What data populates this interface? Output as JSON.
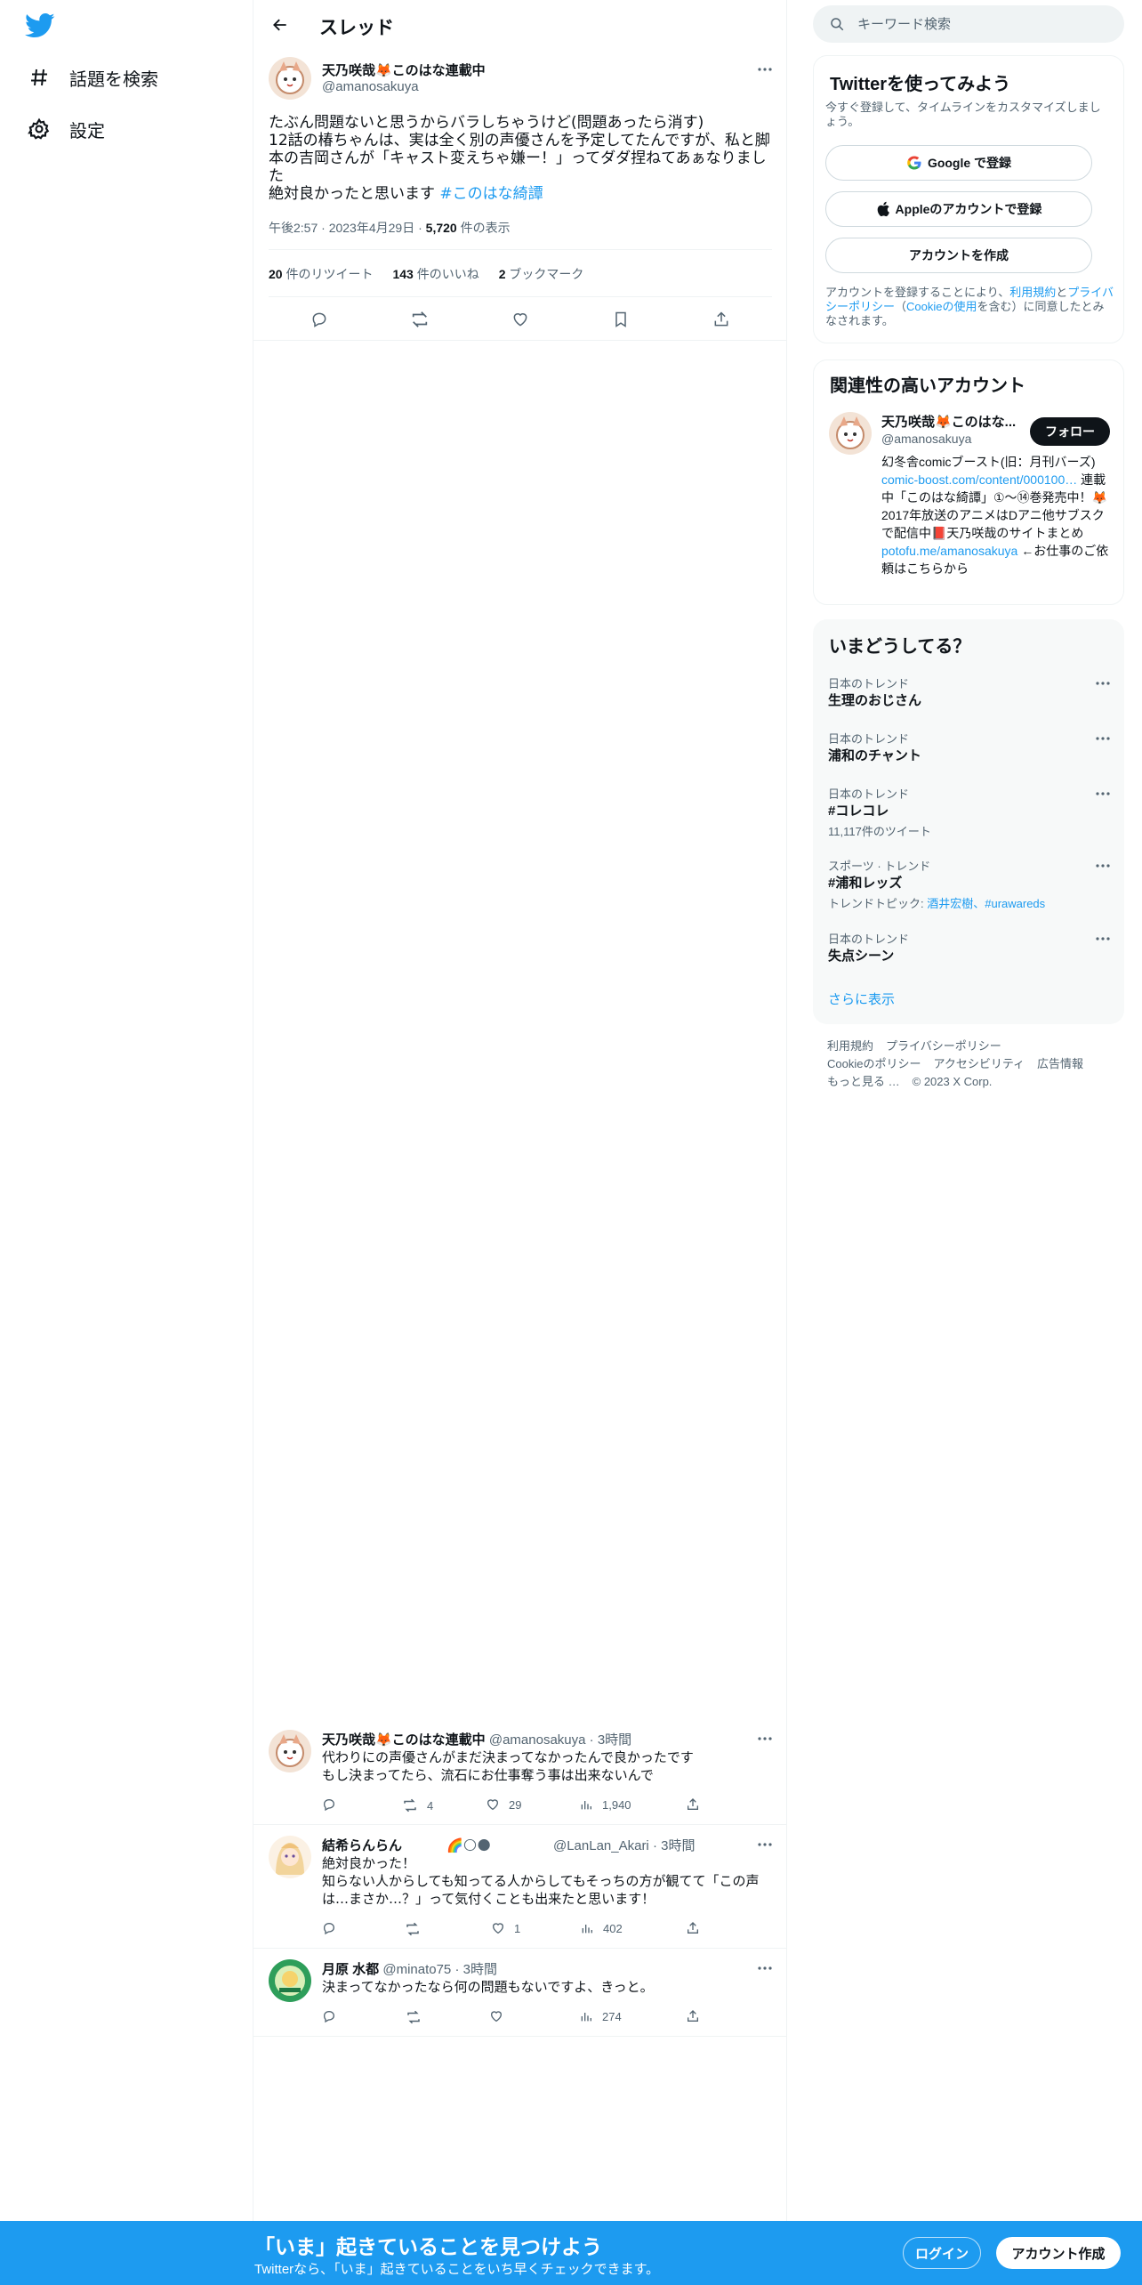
{
  "colors": {
    "accent": "#1d9bf0",
    "text": "#0f1419",
    "muted": "#536471",
    "border": "#eff3f4"
  },
  "nav": {
    "logo_icon": "twitter-bird-icon",
    "items": [
      {
        "label": "話題を検索",
        "icon": "hashtag-icon"
      },
      {
        "label": "設定",
        "icon": "gear-icon"
      }
    ]
  },
  "thread": {
    "title": "スレッド",
    "main_tweet": {
      "name": "天乃咲哉🦊このはな連載中",
      "handle": "@amanosakuya",
      "text": "たぶん問題ないと思うからバラしちゃうけど(問題あったら消す)\n12話の椿ちゃんは、実は全く別の声優さんを予定してたんですが、私と脚本の吉岡さんが「キャスト変えちゃ嫌ー！」ってダダ捏ねてあぁなりました\n絶対良かったと思います ",
      "hashtag": "#このはな綺譚",
      "time": "午後2:57",
      "date": "2023年4月29日",
      "views_count": "5,720",
      "views_label": " 件の表示",
      "retweets_count": "20",
      "retweets_label": " 件のリツイート",
      "likes_count": "143",
      "likes_label": " 件のいいね",
      "bookmarks_count": "2",
      "bookmarks_label": " ブックマーク"
    },
    "replies": [
      {
        "name": "天乃咲哉🦊このはな連載中",
        "handle": "@amanosakuya",
        "time": "3時間",
        "text": "代わりにの声優さんがまだ決まってなかったんで良かったです\nもし決まってたら、流石にお仕事奪う事は出来ないんで",
        "retweets": "4",
        "likes": "29",
        "views": "1,940"
      },
      {
        "name": "結希らんらん",
        "name_emoji": "🌈🌕🌑",
        "handle": "@LanLan_Akari",
        "time": "3時間",
        "text": "絶対良かった！\n知らない人からしても知ってる人からしてもそっちの方が観てて「この声は…まさか…？」って気付くことも出来たと思います！",
        "retweets": "",
        "likes": "1",
        "views": "402"
      },
      {
        "name": "月原 水都",
        "handle": "@minato75",
        "time": "3時間",
        "text": "決まってなかったなら何の問題もないですよ、きっと。",
        "retweets": "",
        "likes": "",
        "views": "274"
      }
    ]
  },
  "sidebar": {
    "search_placeholder": "キーワード検索",
    "signup": {
      "title": "Twitterを使ってみよう",
      "subtitle": "今すぐ登録して、タイムラインをカスタマイズしましょう。",
      "google": "Google で登録",
      "apple": "Appleのアカウントで登録",
      "create": "アカウントを作成",
      "terms_pre": "アカウントを登録することにより、",
      "terms_link": "利用規約",
      "terms_mid": "と",
      "privacy_link": "プライバシーポリシー",
      "cookie_pre": "（",
      "cookie_link": "Cookieの使用",
      "terms_post": "を含む）に同意したとみなされます。"
    },
    "related": {
      "title": "関連性の高いアカウント",
      "name": "天乃咲哉🦊このはな...",
      "handle": "@amanosakuya",
      "follow": "フォロー",
      "bio_1": "幻冬舎comicブースト(旧：月刊バーズ) ",
      "bio_link1": "comic-boost.com/content/000100…",
      "bio_2": " 連載中「このはな綺譚」①〜⑭巻発売中！🦊2017年放送のアニメはDアニ他サブスクで配信中📕天乃咲哉のサイトまとめ ",
      "bio_link2": "potofu.me/amanosakuya",
      "bio_3": " ←お仕事のご依頼はこちらから"
    },
    "trends": {
      "title": "いまどうしてる？",
      "items": [
        {
          "category": "日本のトレンド",
          "name": "生理のおじさん",
          "sub": ""
        },
        {
          "category": "日本のトレンド",
          "name": "浦和のチャント",
          "sub": ""
        },
        {
          "category": "日本のトレンド",
          "name": "#コレコレ",
          "sub": "11,117件のツイート"
        },
        {
          "category": "スポーツ · トレンド",
          "name": "#浦和レッズ",
          "sub_pre": "トレンドトピック: ",
          "sub_link": "酒井宏樹、#urawareds"
        },
        {
          "category": "日本のトレンド",
          "name": "失点シーン",
          "sub": ""
        }
      ],
      "more": "さらに表示"
    },
    "footer": [
      "利用規約",
      "プライバシーポリシー",
      "Cookieのポリシー",
      "アクセシビリティ",
      "広告情報",
      "もっと見る …",
      "© 2023 X Corp."
    ]
  },
  "bottom_bar": {
    "title": "「いま」起きていることを見つけよう",
    "subtitle": "Twitterなら、「いま」起きていることをいち早くチェックできます。",
    "login": "ログイン",
    "signup": "アカウント作成"
  }
}
